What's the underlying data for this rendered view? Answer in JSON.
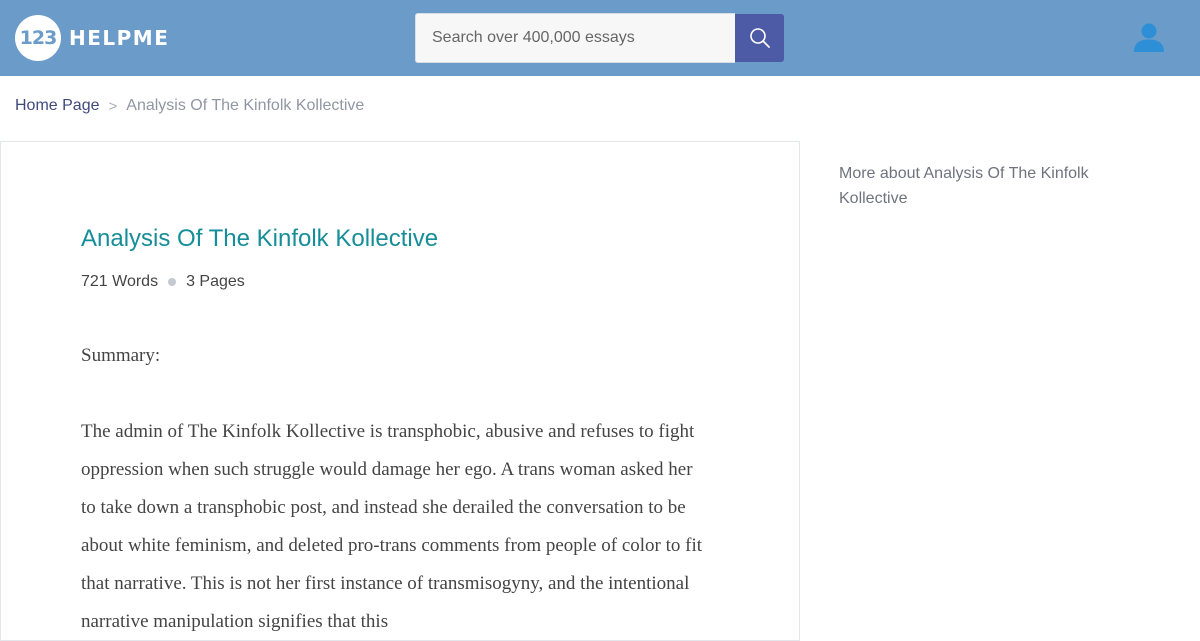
{
  "header": {
    "logo_number": "123",
    "logo_text": "HELPME",
    "search_placeholder": "Search over 400,000 essays"
  },
  "breadcrumb": {
    "home": "Home Page",
    "separator": ">",
    "current": "Analysis Of The Kinfolk Kollective"
  },
  "article": {
    "title": "Analysis Of The Kinfolk Kollective",
    "words": "721 Words",
    "pages": "3 Pages",
    "summary_label": "Summary:",
    "paragraph": "The admin of The Kinfolk Kollective is transphobic, abusive and refuses to fight oppression when such struggle would damage her ego. A trans woman asked her to take down a transphobic post, and instead she derailed the conversation to be about white feminism, and deleted pro-trans comments from people of color to fit that narrative. This is not her first instance of transmisogyny, and the intentional narrative manipulation signifies that this"
  },
  "sidebar": {
    "more_about": "More about Analysis Of The Kinfolk Kollective"
  },
  "colors": {
    "header_bg": "#6b9cc9",
    "search_button": "#4d5aa5",
    "title": "#168e99",
    "user_icon": "#2e8ed6"
  },
  "icons": {
    "search": "search-icon",
    "user": "user-icon"
  }
}
